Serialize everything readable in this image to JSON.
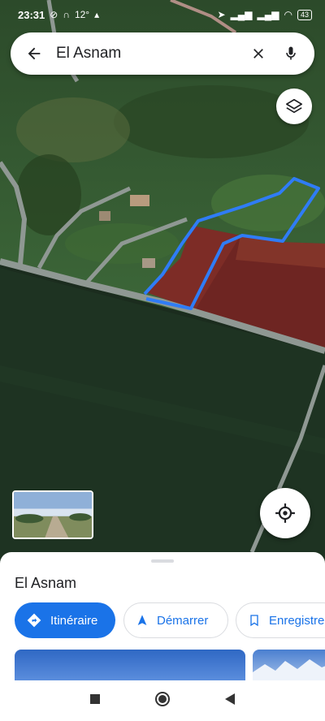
{
  "status_bar": {
    "time": "23:31",
    "temperature": "12°",
    "battery": "43"
  },
  "search": {
    "query": "El Asnam"
  },
  "place_sheet": {
    "title": "El Asnam",
    "actions": [
      {
        "label": "Itinéraire",
        "icon": "directions-icon"
      },
      {
        "label": "Démarrer",
        "icon": "navigation-arrow-icon"
      },
      {
        "label": "Enregistrer",
        "icon": "bookmark-icon"
      }
    ]
  },
  "colors": {
    "accent": "#1a73e8",
    "boundary": "#2f7cf6",
    "field_red": "#7c2a24"
  }
}
